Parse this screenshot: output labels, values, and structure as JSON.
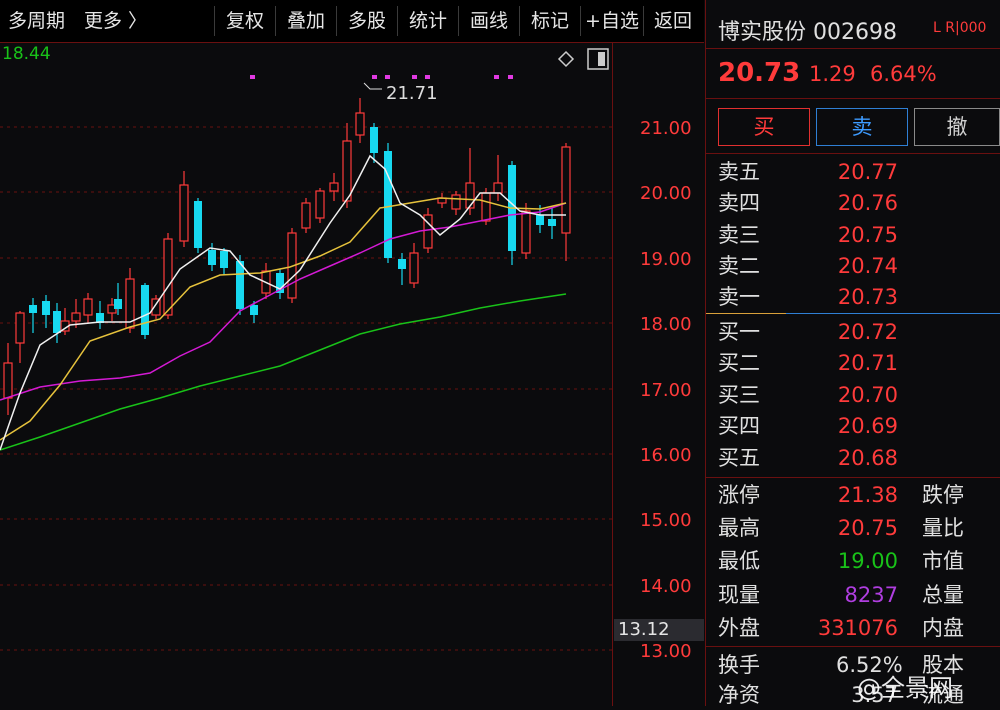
{
  "toolbar": {
    "period": "多周期",
    "more": "更多 〉",
    "items": [
      "复权",
      "叠加",
      "多股",
      "统计",
      "画线",
      "标记",
      "+自选",
      "返回"
    ]
  },
  "chart": {
    "ma_value_label": "18.44",
    "high_marker": "21.71",
    "current_price_tag": "13.12",
    "y_axis_labels": [
      "21.00",
      "20.00",
      "19.00",
      "18.00",
      "17.00",
      "16.00",
      "15.00",
      "14.00",
      "13.00"
    ]
  },
  "quote": {
    "name_code": "博实股份 002698",
    "tag": "L R|000",
    "price": "20.73",
    "change": "1.29",
    "change_pct": "6.64%",
    "buy_label": "买",
    "sell_label": "卖",
    "cancel_label": "撤",
    "asks": [
      {
        "label": "卖五",
        "price": "20.77"
      },
      {
        "label": "卖四",
        "price": "20.76"
      },
      {
        "label": "卖三",
        "price": "20.75"
      },
      {
        "label": "卖二",
        "price": "20.74"
      },
      {
        "label": "卖一",
        "price": "20.73"
      }
    ],
    "bids": [
      {
        "label": "买一",
        "price": "20.72"
      },
      {
        "label": "买二",
        "price": "20.71"
      },
      {
        "label": "买三",
        "price": "20.70"
      },
      {
        "label": "买四",
        "price": "20.69"
      },
      {
        "label": "买五",
        "price": "20.68"
      }
    ],
    "stats": [
      {
        "label": "涨停",
        "value": "21.38",
        "right": "跌停"
      },
      {
        "label": "最高",
        "value": "20.75",
        "right": "量比"
      },
      {
        "label": "最低",
        "value": "19.00",
        "right": "市值"
      },
      {
        "label": "现量",
        "value": "8237",
        "right": "总量"
      },
      {
        "label": "外盘",
        "value": "331076",
        "right": "内盘"
      },
      {
        "label": "换手",
        "value": "6.52%",
        "right": "股本"
      },
      {
        "label": "净资",
        "value": "3.57",
        "right": "流通"
      }
    ]
  },
  "watermark": "@全景网",
  "colors": {
    "up": "#ff3b3b",
    "down": "#17d9f0",
    "ma5": "#f0f0f0",
    "ma10": "#e6c23c",
    "ma20": "#d41ad4",
    "ma60": "#19c219"
  }
}
